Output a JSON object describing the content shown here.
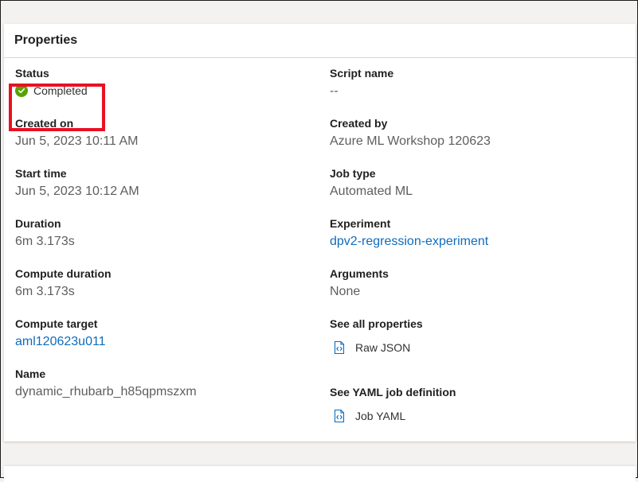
{
  "card": {
    "title": "Properties"
  },
  "left": [
    {
      "label": "Status",
      "status_text": "Completed",
      "status_color": "#57a300",
      "icon": "check-circle-icon"
    },
    {
      "label": "Created on",
      "value": "Jun 5, 2023 10:11 AM"
    },
    {
      "label": "Start time",
      "value": "Jun 5, 2023 10:12 AM"
    },
    {
      "label": "Duration",
      "value": "6m 3.173s"
    },
    {
      "label": "Compute duration",
      "value": "6m 3.173s"
    },
    {
      "label": "Compute target",
      "value": "aml120623u011"
    },
    {
      "label": "Name",
      "value": "dynamic_rhubarb_h85qpmszxm"
    }
  ],
  "right": [
    {
      "label": "Script name",
      "value": "--"
    },
    {
      "label": "Created by",
      "value": "Azure ML Workshop 120623"
    },
    {
      "label": "Job type",
      "value": "Automated ML"
    },
    {
      "label": "Experiment",
      "value": "dpv2-regression-experiment"
    },
    {
      "label": "Arguments",
      "value": "None"
    },
    {
      "label": "See all properties",
      "link": "Raw JSON",
      "icon": "code-file-icon"
    },
    {
      "label": "See YAML job definition",
      "link": "Job YAML",
      "icon": "code-file-icon"
    }
  ],
  "colors": {
    "link": "#0f6cbd",
    "highlight": "#e81123",
    "label": "#201f1e",
    "value": "#605e5c"
  }
}
